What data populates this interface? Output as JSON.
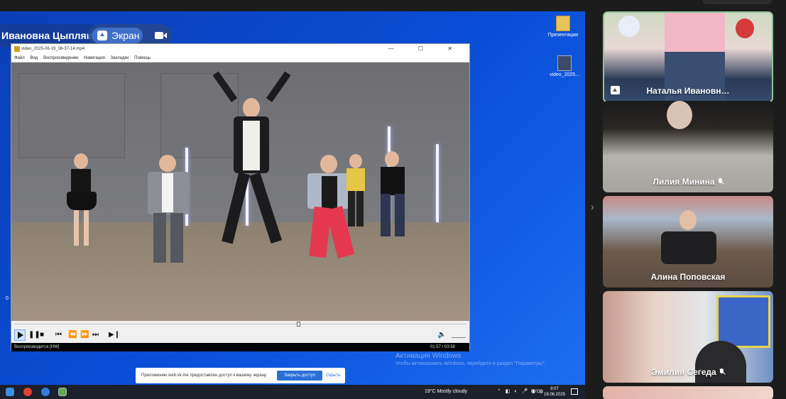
{
  "presenter": {
    "name": "Ивановна Цыпляк"
  },
  "screen_share": {
    "label": "Экран"
  },
  "desktop_icons": [
    {
      "label": "Презентации"
    },
    {
      "label": "video_2025..."
    }
  ],
  "player": {
    "title": "video_2025-06-19_08-37-14.mp4",
    "window_controls": "— ☐ ✕",
    "menu": [
      "Файл",
      "Вид",
      "Воспроизведение",
      "Навигация",
      "Закладки",
      "Помощь"
    ],
    "status": "Воспроизводится [HW]",
    "time": "01:57 / 03:58"
  },
  "activation": {
    "title": "Активация Windows",
    "text": "Чтобы активировать Windows, перейдите в раздел \"Параметры\"."
  },
  "share_banner": {
    "text": "Приложению web.vk.me предоставлен доступ к вашему экрану.",
    "stop": "Закрыть доступ",
    "hide": "Скрыть"
  },
  "taskbar": {
    "weather": "19°C  Mostly cloudy",
    "lang": "РУС",
    "time": "9:07",
    "date": "19.06.2025"
  },
  "edge_number": "0",
  "participants": [
    {
      "name": "Наталья Ивановн…",
      "muted": false,
      "sharing": true
    },
    {
      "name": "Лилия Минина",
      "muted": true
    },
    {
      "name": "Алина Поповская",
      "muted": false
    },
    {
      "name": "Эмилия Сегеда",
      "muted": true
    }
  ]
}
